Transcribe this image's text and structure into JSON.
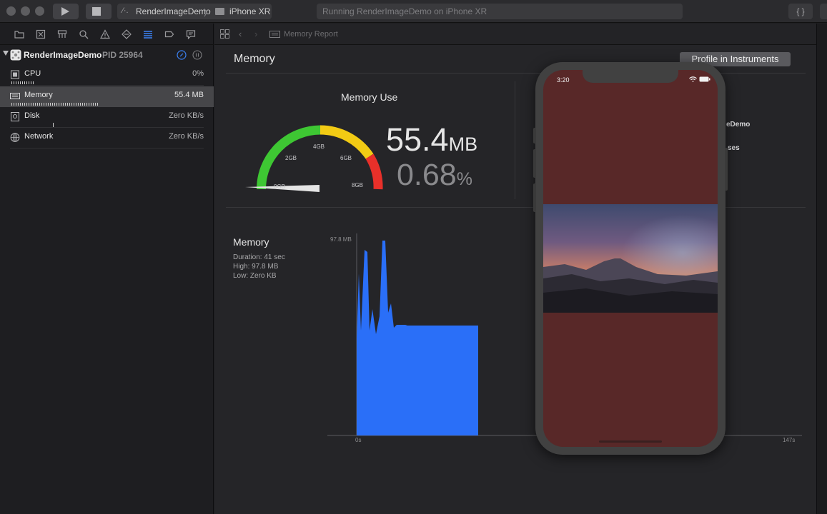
{
  "toolbar": {
    "scheme_target": "RenderImageDemo",
    "device": "iPhone XR",
    "status": "Running RenderImageDemo on iPhone XR",
    "braces": "{ }"
  },
  "navigator": {
    "process_name": "RenderImageDemo",
    "pid": "PID 25964",
    "gauges": [
      {
        "name": "CPU",
        "value": "0%",
        "icon": "cpu-icon"
      },
      {
        "name": "Memory",
        "value": "55.4 MB",
        "icon": "memory-icon"
      },
      {
        "name": "Disk",
        "value": "Zero KB/s",
        "icon": "disk-icon"
      },
      {
        "name": "Network",
        "value": "Zero KB/s",
        "icon": "network-icon"
      }
    ]
  },
  "editor": {
    "breadcrumb": "Memory Report",
    "title": "Memory",
    "profile_button": "Profile in Instruments",
    "gauge_title": "Memory Use",
    "gauge_labels": [
      "0GB",
      "2GB",
      "4GB",
      "6GB",
      "8GB"
    ],
    "memory_value": "55.4",
    "memory_unit": "MB",
    "percent_value": "0.68",
    "percent_unit": "%",
    "partial_text_1": "eDemo",
    "partial_text_2": "ses",
    "graph": {
      "title": "Memory",
      "duration": "Duration: 41 sec",
      "high": "High: 97.8 MB",
      "low": "Low: Zero KB",
      "y_max_label": "97.8 MB",
      "x_start_label": "0s",
      "x_end_label": "147s"
    }
  },
  "simulator": {
    "time": "3:20"
  },
  "colors": {
    "gauge_green": "#3ec733",
    "gauge_yellow": "#f2cb14",
    "gauge_red": "#e8302a",
    "graph_blue": "#2a6ff8",
    "sim_background": "#582828"
  }
}
